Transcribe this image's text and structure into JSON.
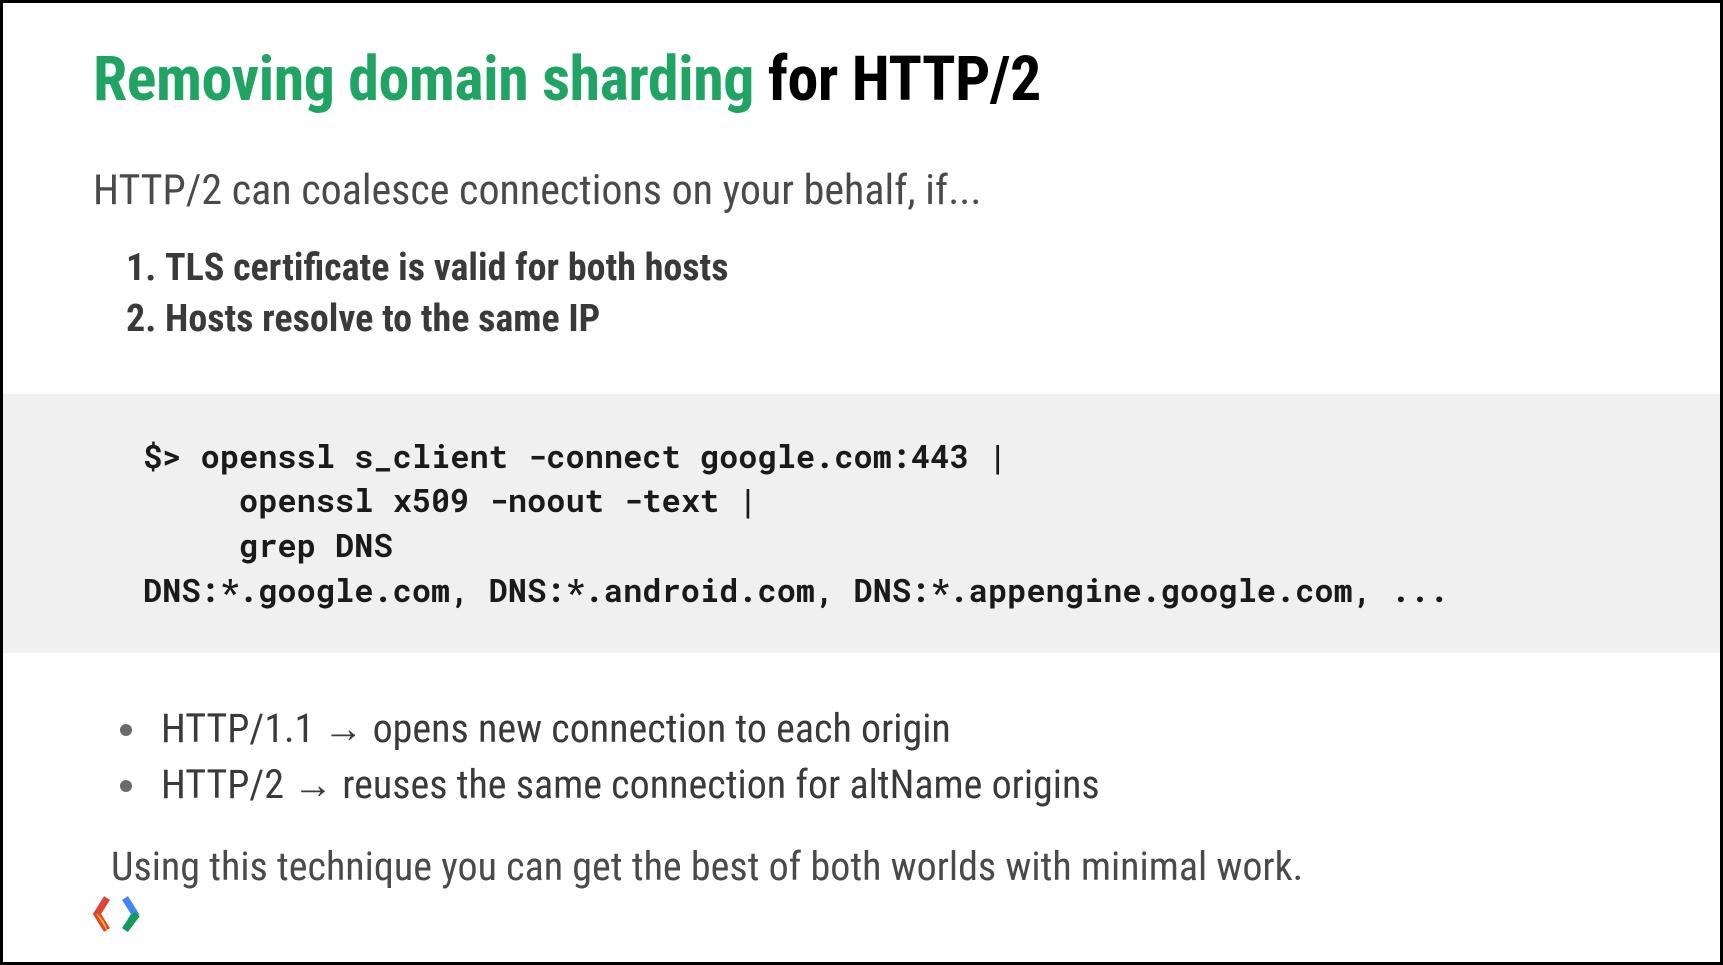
{
  "title": {
    "green": "Removing domain sharding",
    "black": " for HTTP/2"
  },
  "subtitle": "HTTP/2 can coalesce connections on your behalf, if...",
  "conditions": [
    "TLS certificate is valid for both hosts",
    "Hosts resolve to the same IP"
  ],
  "code": "$> openssl s_client -connect google.com:443 |\n     openssl x509 -noout -text |\n     grep DNS\nDNS:*.google.com, DNS:*.android.com, DNS:*.appengine.google.com, ...",
  "bullets": [
    "HTTP/1.1 → opens new connection to each origin",
    "HTTP/2   → reuses the same connection for altName origins"
  ],
  "closing": "Using this technique you can get the best of both worlds with minimal work."
}
